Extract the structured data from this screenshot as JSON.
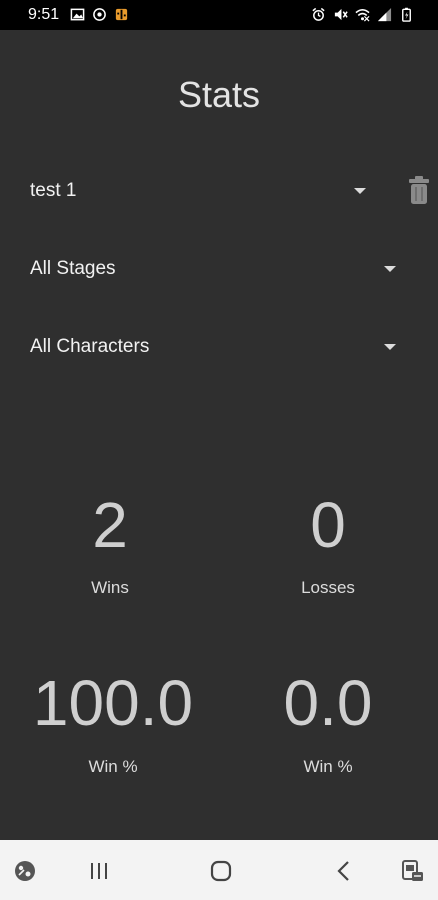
{
  "status_bar": {
    "time": "9:51",
    "left_icons": [
      "image-icon",
      "location-icon",
      "game-icon"
    ],
    "right_icons": [
      "alarm-icon",
      "mute-icon",
      "wifi-icon",
      "signal-icon",
      "battery-icon"
    ]
  },
  "header": {
    "title": "Stats"
  },
  "filters": {
    "profile": {
      "value": "test 1"
    },
    "stage": {
      "value": "All Stages"
    },
    "character": {
      "value": "All Characters"
    }
  },
  "stats": {
    "wins": {
      "value": "2",
      "label": "Wins"
    },
    "losses": {
      "value": "0",
      "label": "Losses"
    },
    "win_pct_left": {
      "value": "100.0",
      "label": "Win %"
    },
    "win_pct_right": {
      "value": "0.0",
      "label": "Win %"
    }
  },
  "nav_bar": {
    "icons": [
      "accessibility-icon",
      "recent-apps-icon",
      "home-icon",
      "back-icon",
      "keyboard-switch-icon"
    ]
  },
  "colors": {
    "background": "#2f2f2f",
    "status_bar": "#000000",
    "nav_bar": "#f3f3f3",
    "game_icon_accent": "#e89a2c"
  }
}
